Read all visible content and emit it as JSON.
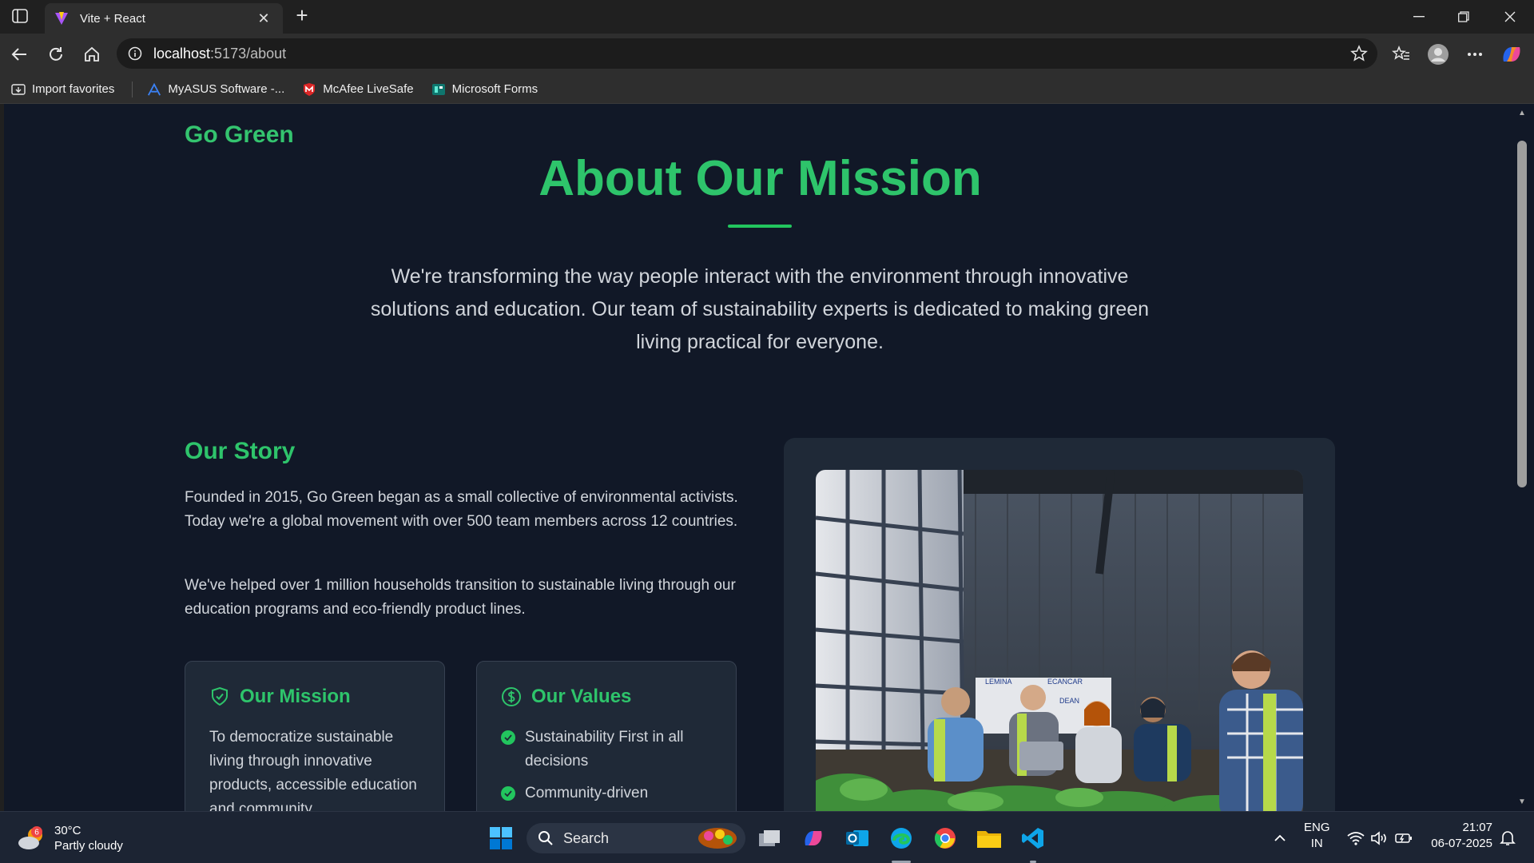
{
  "browser": {
    "tab_title": "Vite + React",
    "url_host": "localhost",
    "url_path": ":5173/about",
    "bookmarks": [
      {
        "label": "Import favorites",
        "icon": "import-icon"
      },
      {
        "label": "MyASUS Software -...",
        "icon": "asus-icon"
      },
      {
        "label": "McAfee LiveSafe",
        "icon": "mcafee-icon"
      },
      {
        "label": "Microsoft Forms",
        "icon": "forms-icon"
      }
    ]
  },
  "page": {
    "brand": "Go Green",
    "hero_title": "About Our Mission",
    "hero_text": "We're transforming the way people interact with the environment through innovative solutions and education. Our team of sustainability experts is dedicated to making green living practical for everyone.",
    "story": {
      "heading": "Our Story",
      "p1": "Founded in 2015, Go Green began as a small collective of environmental activists. Today we're a global movement with over 500 team members across 12 countries.",
      "p2": "We've helped over 1 million households transition to sustainable living through our education programs and eco-friendly product lines."
    },
    "mission": {
      "heading": "Our Mission",
      "text": "To democratize sustainable living through innovative products, accessible education and community"
    },
    "values": {
      "heading": "Our Values",
      "items": [
        "Sustainability First in all decisions",
        "Community-driven"
      ]
    },
    "photo_banner": [
      "LEMINA",
      "ECANCAR",
      "DEAN"
    ]
  },
  "taskbar": {
    "temperature": "30°C",
    "weather": "Partly cloudy",
    "weather_badge": "6",
    "search_placeholder": "Search",
    "lang_top": "ENG",
    "lang_bottom": "IN",
    "time": "21:07",
    "date": "06-07-2025"
  },
  "colors": {
    "page_bg": "#111827",
    "accent_green": "#2ec46b",
    "card_bg": "#1f2937"
  }
}
